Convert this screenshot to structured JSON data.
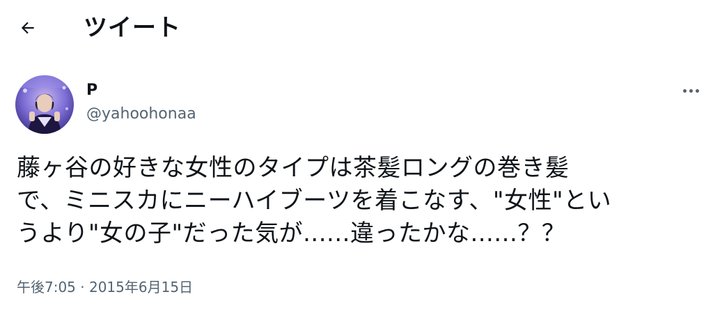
{
  "header": {
    "back_icon": "arrow-left-icon",
    "title": "ツイート"
  },
  "tweet": {
    "author": {
      "display_name": "P",
      "handle": "@yahoohonaa",
      "avatar_icon": "user-avatar"
    },
    "more_icon": "more-horizontal-icon",
    "text": "藤ヶ谷の好きな女性のタイプは茶髪ロングの巻き髪\nで、ミニスカにニーハイブーツを着こなす、\"女性\"とい\nうより\"女の子\"だった気が......違ったかな......？？",
    "timestamp": "午後7:05 · 2015年6月15日"
  },
  "colors": {
    "text_primary": "#0f1419",
    "text_secondary": "#536471",
    "background": "#ffffff"
  }
}
